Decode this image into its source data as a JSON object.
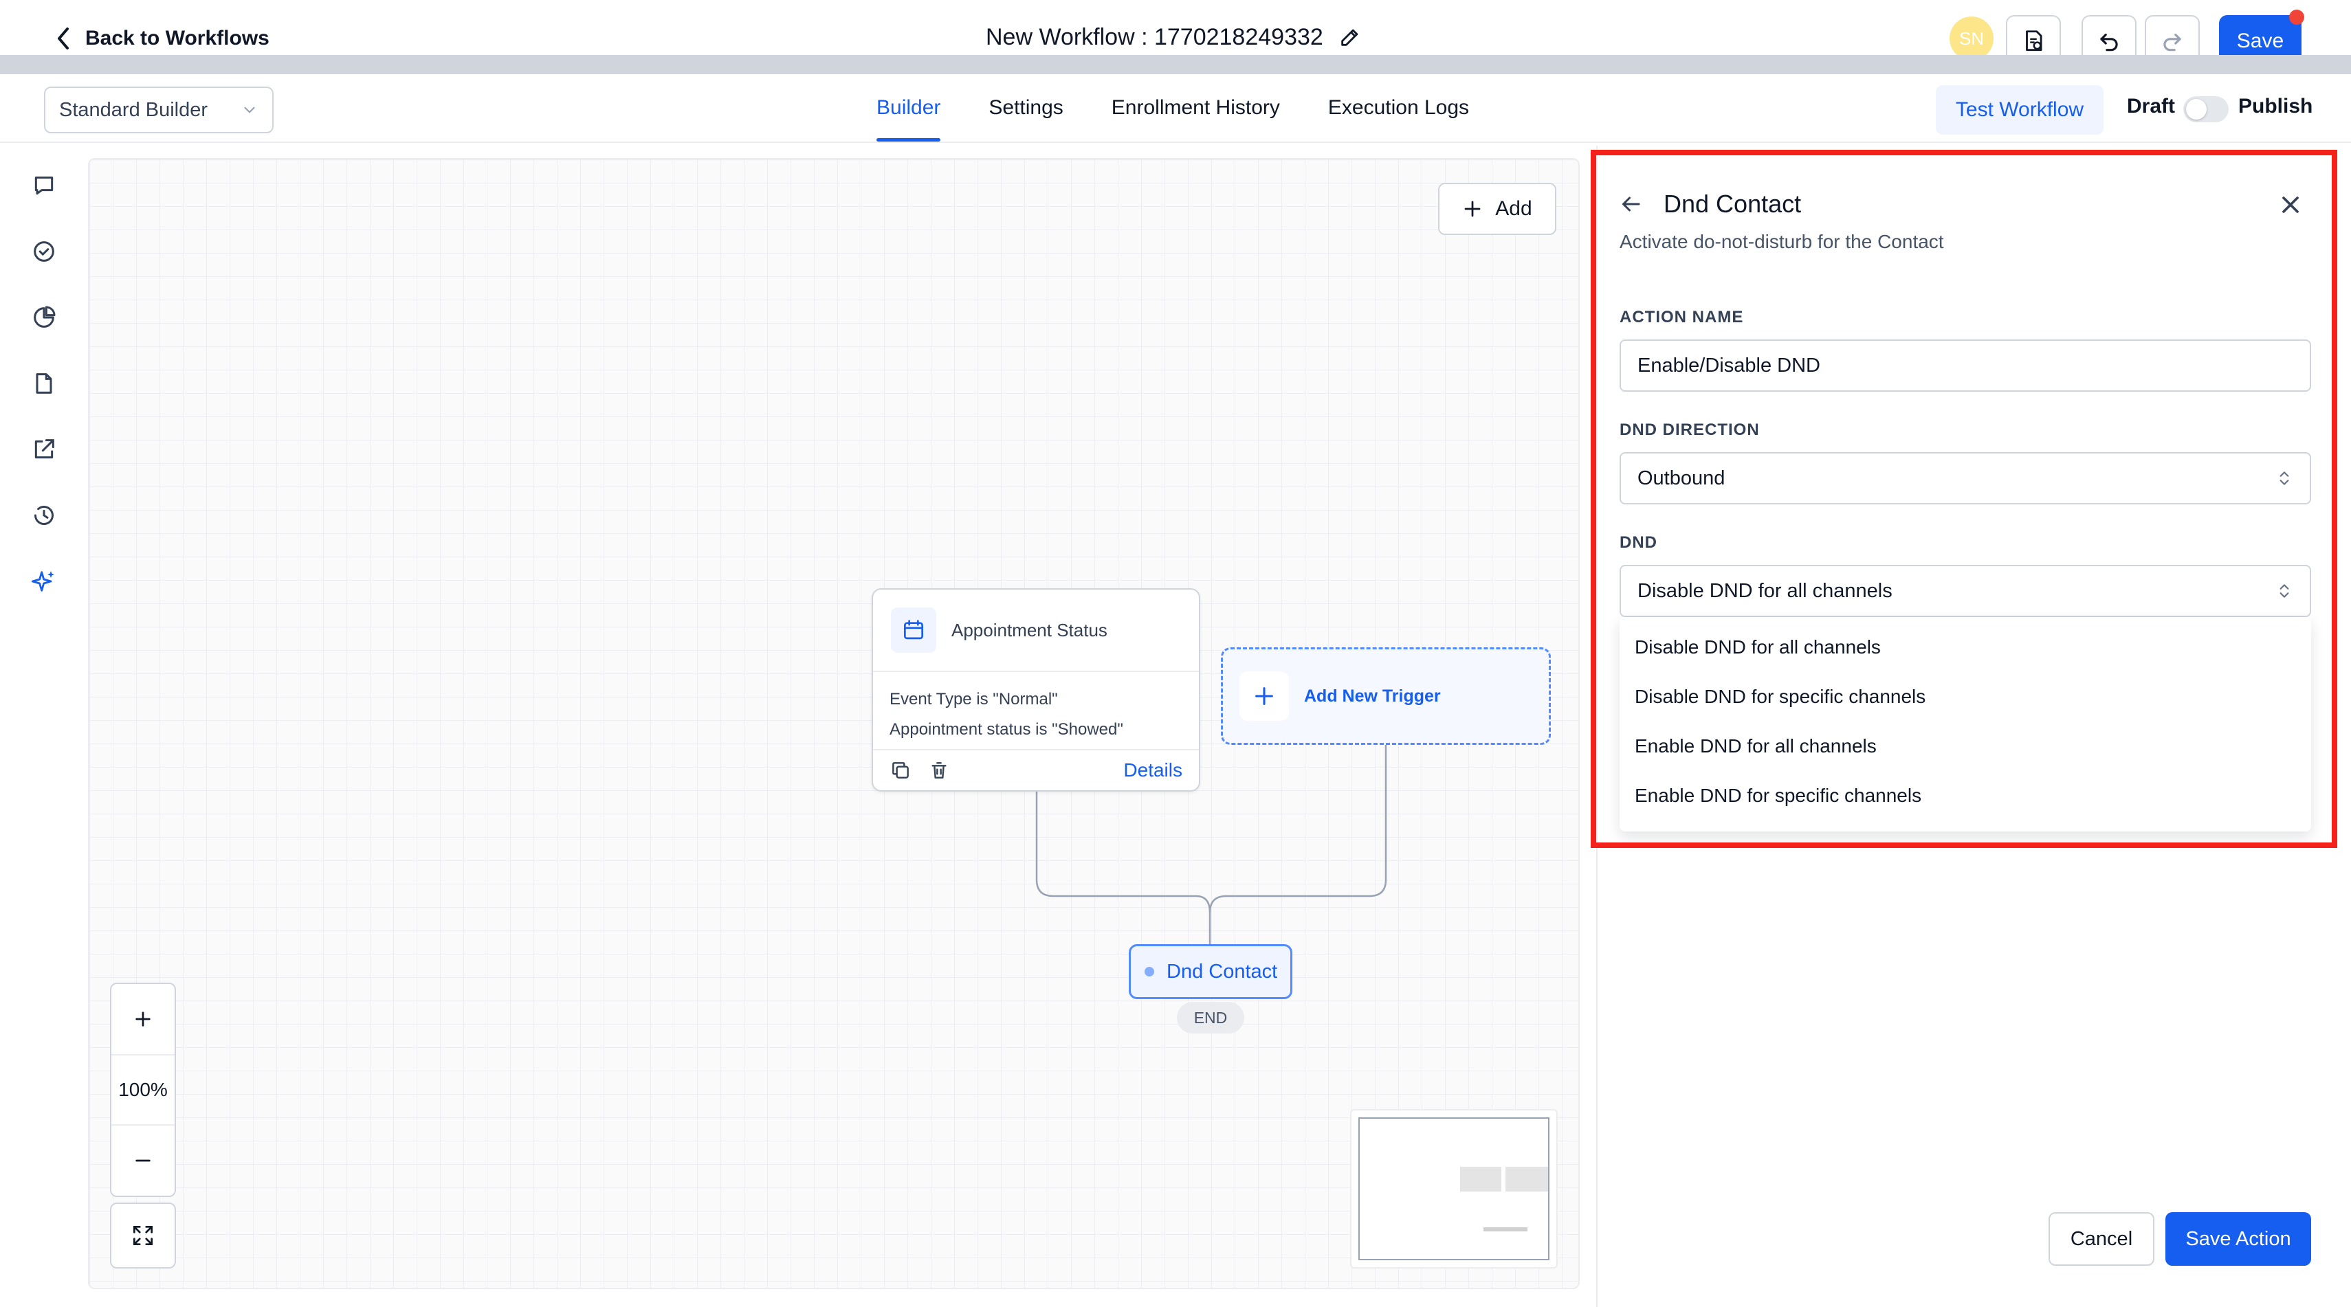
{
  "header": {
    "back_label": "Back to Workflows",
    "workflow_title": "New Workflow : 1770218249332",
    "avatar_initials": "SN",
    "save_label": "Save"
  },
  "subbar": {
    "builder_select_value": "Standard Builder",
    "tabs": [
      {
        "label": "Builder",
        "active": true
      },
      {
        "label": "Settings",
        "active": false
      },
      {
        "label": "Enrollment History",
        "active": false
      },
      {
        "label": "Execution Logs",
        "active": false
      }
    ],
    "test_workflow_label": "Test Workflow",
    "draft_label": "Draft",
    "publish_label": "Publish",
    "publish_toggle_on": false
  },
  "rail": {
    "items": [
      "chat-icon",
      "check-circle-icon",
      "pie-chart-icon",
      "document-icon",
      "external-link-icon",
      "history-icon",
      "sparkle-icon"
    ]
  },
  "canvas": {
    "add_label": "Add",
    "trigger": {
      "title": "Appointment Status",
      "conditions": [
        "Event Type is \"Normal\"",
        "Appointment status is \"Showed\""
      ],
      "details_label": "Details"
    },
    "add_trigger_label": "Add New Trigger",
    "action_node_label": "Dnd Contact",
    "end_label": "END",
    "zoom_level": "100%"
  },
  "panel": {
    "title": "Dnd Contact",
    "subtitle": "Activate do-not-disturb for the Contact",
    "action_name_label": "ACTION NAME",
    "action_name_value": "Enable/Disable DND",
    "direction_label": "DND DIRECTION",
    "direction_value": "Outbound",
    "dnd_label": "DND",
    "dnd_value": "Disable DND for all channels",
    "dnd_options": [
      "Disable DND for all channels",
      "Disable DND for specific channels",
      "Enable DND for all channels",
      "Enable DND for specific channels"
    ],
    "cancel_label": "Cancel",
    "save_action_label": "Save Action"
  },
  "colors": {
    "primary": "#155eef",
    "highlight_border": "#f5221b",
    "notification_dot": "#f04438"
  }
}
